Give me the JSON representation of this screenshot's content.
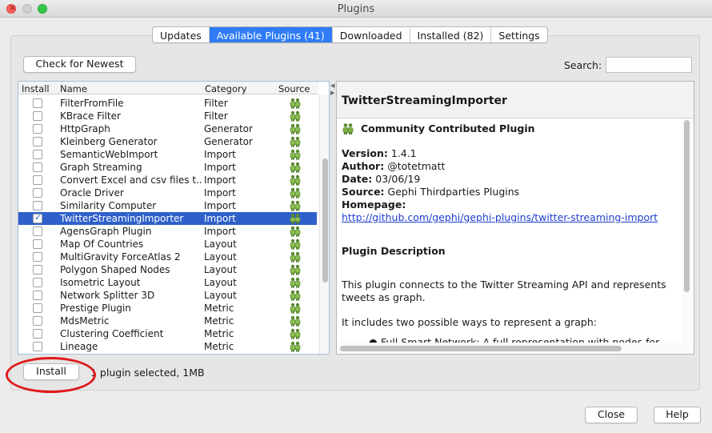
{
  "window": {
    "title": "Plugins"
  },
  "tabs": [
    {
      "label": "Updates",
      "active": false
    },
    {
      "label": "Available Plugins (41)",
      "active": true
    },
    {
      "label": "Downloaded",
      "active": false
    },
    {
      "label": "Installed (82)",
      "active": false
    },
    {
      "label": "Settings",
      "active": false
    }
  ],
  "toolbar": {
    "check_label": "Check for Newest",
    "search_label": "Search:",
    "search_value": ""
  },
  "table": {
    "headers": {
      "install": "Install",
      "name": "Name",
      "category": "Category",
      "source": "Source"
    },
    "rows": [
      {
        "name": "FilterFromFile",
        "category": "Filter",
        "checked": false,
        "selected": false
      },
      {
        "name": "KBrace Filter",
        "category": "Filter",
        "checked": false,
        "selected": false
      },
      {
        "name": "HttpGraph",
        "category": "Generator",
        "checked": false,
        "selected": false
      },
      {
        "name": "Kleinberg Generator",
        "category": "Generator",
        "checked": false,
        "selected": false
      },
      {
        "name": "SemanticWebImport",
        "category": "Import",
        "checked": false,
        "selected": false
      },
      {
        "name": "Graph Streaming",
        "category": "Import",
        "checked": false,
        "selected": false
      },
      {
        "name": "Convert Excel and csv files t...",
        "category": "Import",
        "checked": false,
        "selected": false
      },
      {
        "name": "Oracle Driver",
        "category": "Import",
        "checked": false,
        "selected": false
      },
      {
        "name": "Similarity Computer",
        "category": "Import",
        "checked": false,
        "selected": false
      },
      {
        "name": "TwitterStreamingImporter",
        "category": "Import",
        "checked": true,
        "selected": true
      },
      {
        "name": "AgensGraph Plugin",
        "category": "Import",
        "checked": false,
        "selected": false
      },
      {
        "name": "Map Of Countries",
        "category": "Layout",
        "checked": false,
        "selected": false
      },
      {
        "name": "MultiGravity ForceAtlas 2",
        "category": "Layout",
        "checked": false,
        "selected": false
      },
      {
        "name": "Polygon Shaped Nodes",
        "category": "Layout",
        "checked": false,
        "selected": false
      },
      {
        "name": "Isometric Layout",
        "category": "Layout",
        "checked": false,
        "selected": false
      },
      {
        "name": "Network Splitter 3D",
        "category": "Layout",
        "checked": false,
        "selected": false
      },
      {
        "name": "Prestige Plugin",
        "category": "Metric",
        "checked": false,
        "selected": false
      },
      {
        "name": "MdsMetric",
        "category": "Metric",
        "checked": false,
        "selected": false
      },
      {
        "name": "Clustering Coefficient",
        "category": "Metric",
        "checked": false,
        "selected": false
      },
      {
        "name": "Lineage",
        "category": "Metric",
        "checked": false,
        "selected": false
      }
    ],
    "source_icon": "community-people-icon"
  },
  "details": {
    "title": "TwitterStreamingImporter",
    "badge": "Community Contributed Plugin",
    "version_label": "Version:",
    "version": "1.4.1",
    "author_label": "Author:",
    "author": "@totetmatt",
    "date_label": "Date:",
    "date": "03/06/19",
    "source_label": "Source:",
    "source": "Gephi Thirdparties Plugins",
    "homepage_label": "Homepage:",
    "homepage": "http://github.com/gephi/gephi-plugins/twitter-streaming-import",
    "desc_heading": "Plugin Description",
    "desc_p1_l1": "This plugin connects to the Twitter Streaming API and represents",
    "desc_p1_l2": "tweets as graph.",
    "desc_p2": "It includes two possible ways to represent a graph:",
    "desc_bullet": "Full Smart Network: A full representation with nodes for"
  },
  "footer": {
    "install_label": "Install",
    "status": "1 plugin selected, 1MB",
    "close_label": "Close",
    "help_label": "Help"
  },
  "colors": {
    "accent": "#2f7cf6",
    "selection": "#2f60c9",
    "annotation": "#e0191c"
  }
}
